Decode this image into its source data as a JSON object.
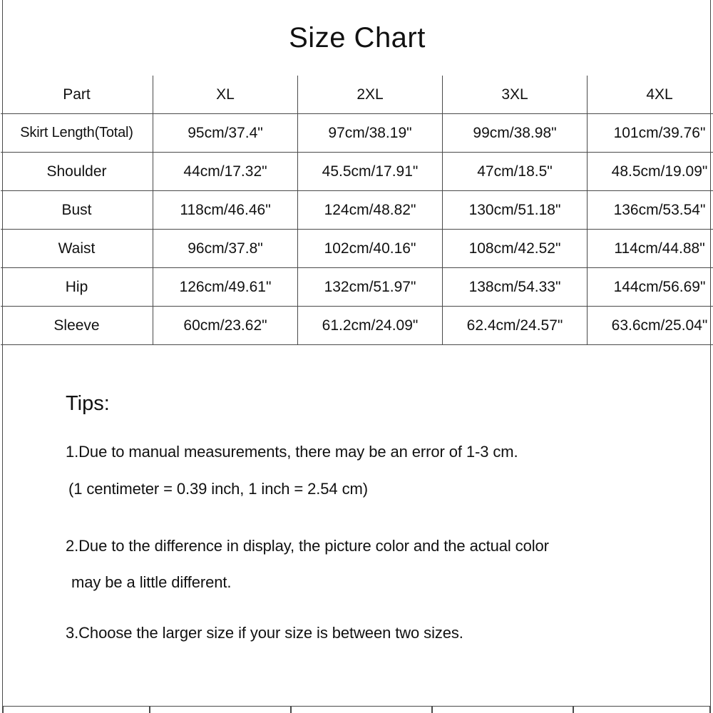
{
  "title": "Size Chart",
  "table": {
    "columns": [
      "Part",
      "XL",
      "2XL",
      "3XL",
      "4XL"
    ],
    "rows": [
      {
        "part": "Skirt Length(Total)",
        "values": [
          "95cm/37.4\"",
          "97cm/38.19\"",
          "99cm/38.98\"",
          "101cm/39.76\""
        ]
      },
      {
        "part": "Shoulder",
        "values": [
          "44cm/17.32\"",
          "45.5cm/17.91\"",
          "47cm/18.5\"",
          "48.5cm/19.09\""
        ]
      },
      {
        "part": "Bust",
        "values": [
          "118cm/46.46\"",
          "124cm/48.82\"",
          "130cm/51.18\"",
          "136cm/53.54\""
        ]
      },
      {
        "part": "Waist",
        "values": [
          "96cm/37.8\"",
          "102cm/40.16\"",
          "108cm/42.52\"",
          "114cm/44.88\""
        ]
      },
      {
        "part": "Hip",
        "values": [
          "126cm/49.61\"",
          "132cm/51.97\"",
          "138cm/54.33\"",
          "144cm/56.69\""
        ]
      },
      {
        "part": "Sleeve",
        "values": [
          "60cm/23.62\"",
          "61.2cm/24.09\"",
          "62.4cm/24.57\"",
          "63.6cm/25.04\""
        ]
      }
    ]
  },
  "tips": {
    "heading": "Tips:",
    "line_1a": "1.Due to manual measurements, there may be an error of 1-3 cm.",
    "line_1b": "(1 centimeter = 0.39 inch, 1 inch = 2.54 cm)",
    "line_2a": "2.Due to the difference in display, the picture color and the actual color",
    "line_2b": "may be a little different.",
    "line_3a": "3.Choose the larger size if your size is between two sizes."
  },
  "colors": {
    "background": "#ffffff",
    "text": "#111111",
    "border": "#4a4a4a"
  },
  "chart_data": {
    "type": "table",
    "title": "Size Chart",
    "categories": [
      "XL",
      "2XL",
      "3XL",
      "4XL"
    ],
    "series": [
      {
        "name": "Skirt Length(Total)",
        "unit_cm": "cm",
        "values_cm": [
          95,
          97,
          99,
          101
        ],
        "values_in": [
          37.4,
          38.19,
          38.98,
          39.76
        ]
      },
      {
        "name": "Shoulder",
        "unit_cm": "cm",
        "values_cm": [
          44,
          45.5,
          47,
          48.5
        ],
        "values_in": [
          17.32,
          17.91,
          18.5,
          19.09
        ]
      },
      {
        "name": "Bust",
        "unit_cm": "cm",
        "values_cm": [
          118,
          124,
          130,
          136
        ],
        "values_in": [
          46.46,
          48.82,
          51.18,
          53.54
        ]
      },
      {
        "name": "Waist",
        "unit_cm": "cm",
        "values_cm": [
          96,
          102,
          108,
          114
        ],
        "values_in": [
          37.8,
          40.16,
          42.52,
          44.88
        ]
      },
      {
        "name": "Hip",
        "unit_cm": "cm",
        "values_cm": [
          126,
          132,
          138,
          144
        ],
        "values_in": [
          49.61,
          51.97,
          54.33,
          56.69
        ]
      },
      {
        "name": "Sleeve",
        "unit_cm": "cm",
        "values_cm": [
          60,
          61.2,
          62.4,
          63.6
        ],
        "values_in": [
          23.62,
          24.09,
          24.57,
          25.04
        ]
      }
    ],
    "xlabel": "Part",
    "ylabel": "",
    "grid": true,
    "legend": "none"
  }
}
